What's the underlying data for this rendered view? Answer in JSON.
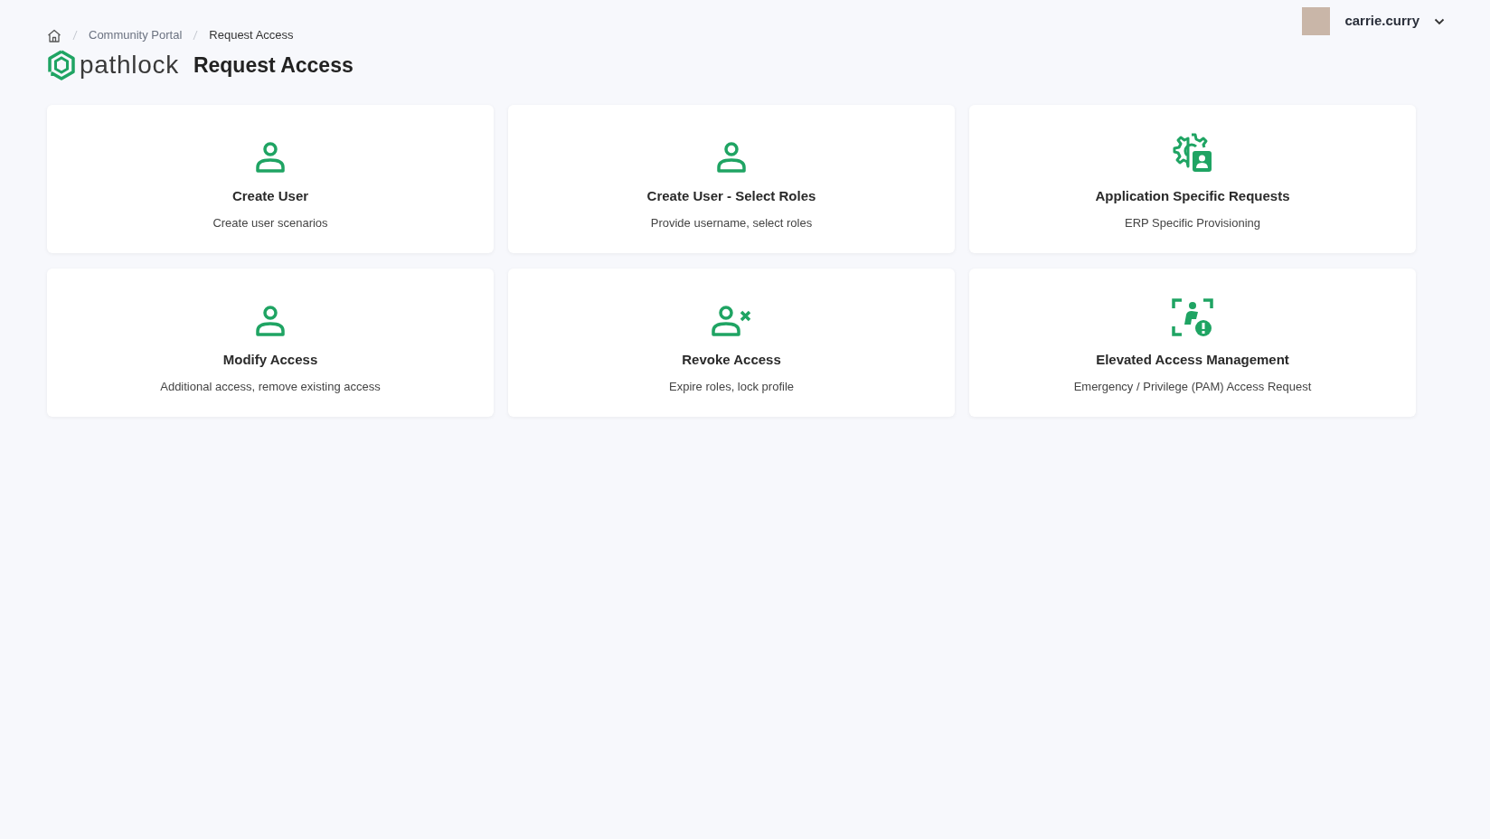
{
  "breadcrumb": [
    {
      "label": "Community Portal",
      "current": false
    },
    {
      "label": "Request Access",
      "current": true
    }
  ],
  "logo": {
    "text": "pathlock"
  },
  "page_title": "Request Access",
  "user_menu": {
    "username": "carrie.curry"
  },
  "cards": [
    {
      "kind": "user",
      "title": "Create User",
      "subtitle": "Create user scenarios"
    },
    {
      "kind": "user",
      "title": "Create User - Select Roles",
      "subtitle": "Provide username, select roles"
    },
    {
      "kind": "settings",
      "title": "Application Specific Requests",
      "subtitle": "ERP Specific Provisioning"
    },
    {
      "kind": "user",
      "title": "Modify Access",
      "subtitle": "Additional access, remove existing access"
    },
    {
      "kind": "revoke",
      "title": "Revoke Access",
      "subtitle": "Expire roles, lock profile"
    },
    {
      "kind": "alert",
      "title": "Elevated Access Management",
      "subtitle": "Emergency / Privilege (PAM) Access Request"
    }
  ]
}
